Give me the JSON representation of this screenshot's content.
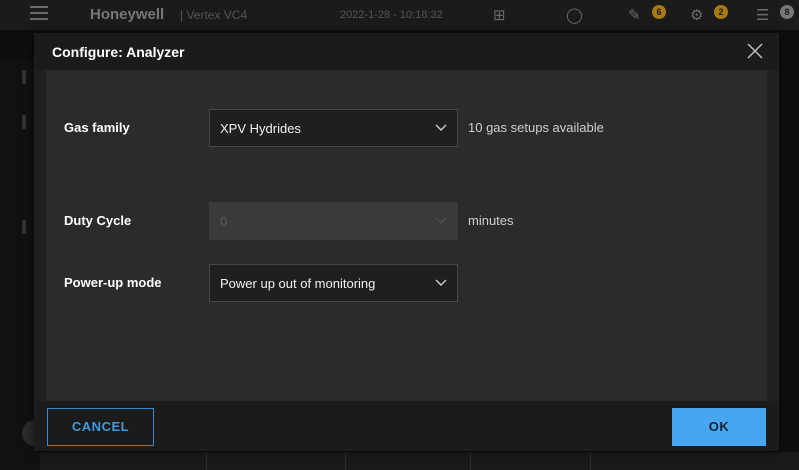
{
  "background": {
    "brand": "Honeywell",
    "product": "| Vertex VC4",
    "datetime": "2022-1-28 - 10:18:32",
    "badges": [
      "6",
      "2",
      "8"
    ]
  },
  "dialog": {
    "title": "Configure: Analyzer",
    "fields": [
      {
        "label": "Gas family",
        "value": "XPV Hydrides",
        "suffix": "10 gas setups available",
        "disabled": false
      },
      {
        "label": "Duty Cycle",
        "value": "0",
        "suffix": "minutes",
        "disabled": true
      },
      {
        "label": "Power-up mode",
        "value": "Power up out of monitoring",
        "suffix": "",
        "disabled": false
      }
    ],
    "cancel_label": "CANCEL",
    "ok_label": "OK"
  },
  "colors": {
    "accent": "#47a6ef",
    "cancel_border": "#2f8fd4",
    "dialog_bg": "#202020",
    "body_bg": "#2b2b2b"
  },
  "icons": {
    "close": "close-icon",
    "dropdown": "chevron-down-icon"
  }
}
